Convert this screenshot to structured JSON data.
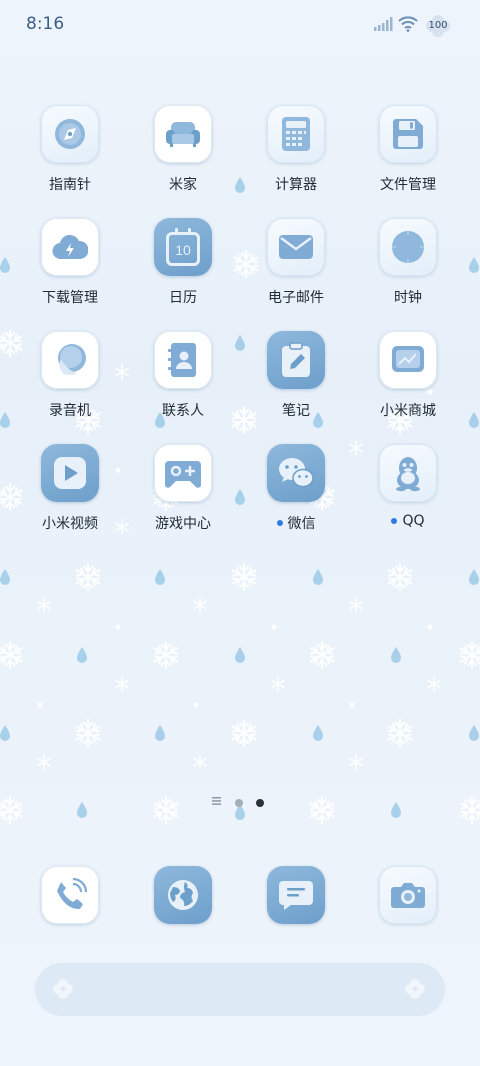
{
  "status_bar": {
    "time": "8:16",
    "battery": "100"
  },
  "apps": [
    {
      "label": "指南针",
      "icon": "compass-icon"
    },
    {
      "label": "米家",
      "icon": "sofa-icon"
    },
    {
      "label": "计算器",
      "icon": "calculator-icon"
    },
    {
      "label": "文件管理",
      "icon": "floppy-disk-icon"
    },
    {
      "label": "下载管理",
      "icon": "cloud-download-icon"
    },
    {
      "label": "日历",
      "icon": "calendar-icon",
      "calendar_day": "10"
    },
    {
      "label": "电子邮件",
      "icon": "envelope-icon"
    },
    {
      "label": "时钟",
      "icon": "clock-icon"
    },
    {
      "label": "录音机",
      "icon": "recorder-icon"
    },
    {
      "label": "联系人",
      "icon": "contacts-book-icon"
    },
    {
      "label": "笔记",
      "icon": "notes-pencil-icon"
    },
    {
      "label": "小米商城",
      "icon": "store-chart-icon"
    },
    {
      "label": "小米视频",
      "icon": "play-video-icon"
    },
    {
      "label": "游戏中心",
      "icon": "gamepad-icon"
    },
    {
      "label": "微信",
      "icon": "wechat-icon",
      "new_install_dot": true
    },
    {
      "label": "QQ",
      "icon": "qq-penguin-icon",
      "new_install_dot": true
    }
  ],
  "pager": {
    "pages": 2,
    "current": 2
  },
  "dock": [
    {
      "name": "phone",
      "icon": "phone-icon"
    },
    {
      "name": "browser",
      "icon": "globe-icon"
    },
    {
      "name": "messages",
      "icon": "message-icon"
    },
    {
      "name": "camera",
      "icon": "camera-icon"
    }
  ],
  "colors": {
    "accent": "#6d9fcb",
    "dot": "#2f7be5",
    "time": "#3c5e86"
  }
}
